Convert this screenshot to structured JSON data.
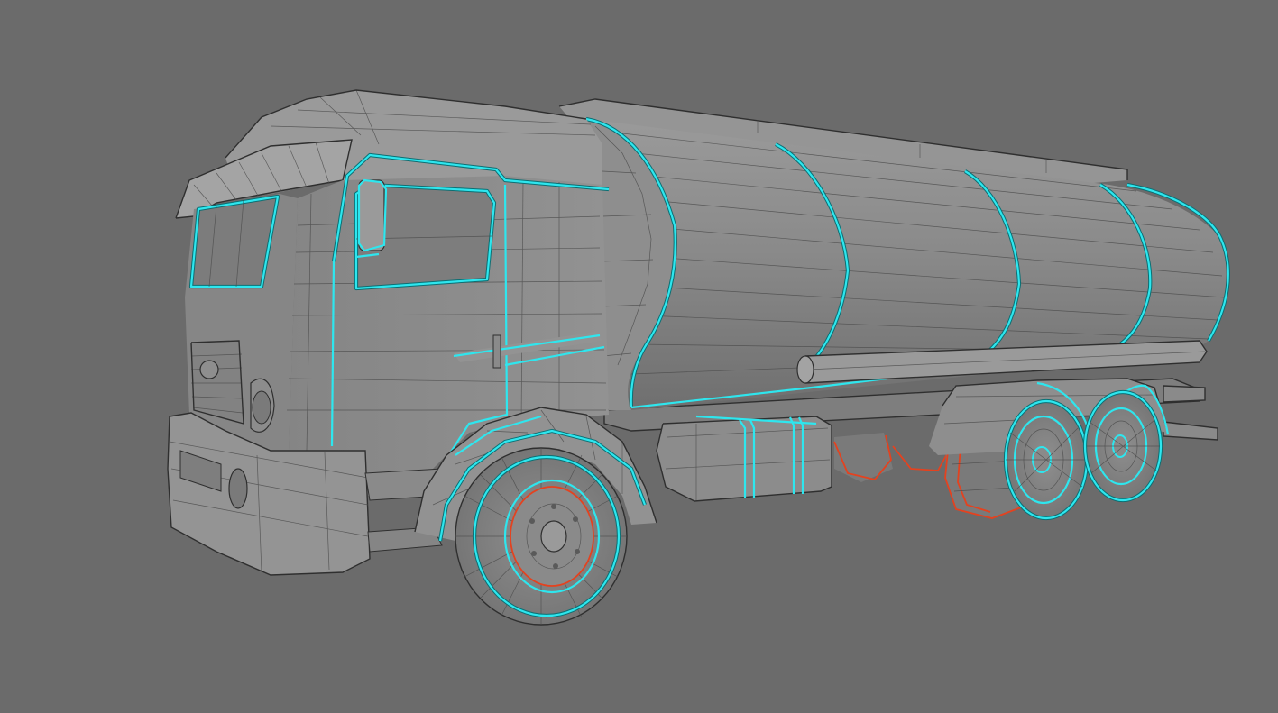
{
  "scene": {
    "background": "#6b6b6b",
    "model_color": "#8b8b8b",
    "selection_color": "#2ee6ee",
    "secondary_selection_color": "#e4421f",
    "wireframe_color": "#4a4a4a"
  }
}
